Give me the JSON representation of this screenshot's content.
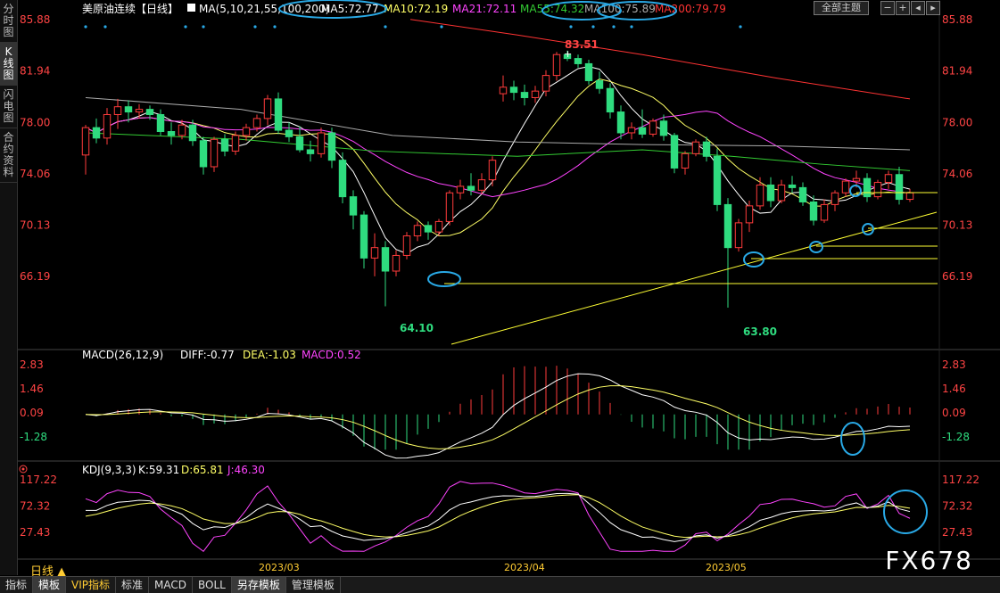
{
  "left_tabs": [
    "分时图",
    "K线图",
    "闪电图",
    "合约资料"
  ],
  "top_buttons": {
    "theme": "全部主题"
  },
  "day_button": "日线 ▲",
  "watermark": "FX678",
  "bottom_tabs": [
    "指标",
    "模板",
    "VIP指标",
    "标准",
    "MACD",
    "BOLL",
    "另存模板",
    "管理模板"
  ],
  "colors": {
    "up": "#ff3b3b",
    "down": "#2fdc7f",
    "ma5": "#ffffff",
    "ma10": "#ffff66",
    "ma21": "#ff44ff",
    "ma55": "#33cc33",
    "ma100": "#aaaaaa",
    "ma200": "#ff3333",
    "axis": "#ff4444",
    "annot": "#29a9e6"
  },
  "price_panel": {
    "title": "美原油连续【日线】",
    "ma_label": "MA(5,10,21,55,100,200)",
    "ma_values": [
      {
        "name": "MA5",
        "value": "MA5:72.77",
        "color": "#ffffff"
      },
      {
        "name": "MA10",
        "value": "MA10:72.19",
        "color": "#ffff66"
      },
      {
        "name": "MA21",
        "value": "MA21:72.11",
        "color": "#ff44ff"
      },
      {
        "name": "MA55",
        "value": "MA55:74.32",
        "color": "#33cc33"
      },
      {
        "name": "MA100",
        "value": "MA100:75.89",
        "color": "#aaaaaa"
      },
      {
        "name": "MA200",
        "value": "MA200:79.79",
        "color": "#ff3333"
      }
    ],
    "yticks": [
      "85.88",
      "81.94",
      "78.00",
      "74.06",
      "70.13",
      "66.19"
    ],
    "high_label": "83.51",
    "low_label_1": "64.10",
    "low_label_2": "63.80"
  },
  "macd_panel": {
    "label": "MACD(26,12,9)",
    "diff": "DIFF:-0.77",
    "dea": "DEA:-1.03",
    "macd": "MACD:0.52",
    "yticks": [
      "2.83",
      "1.46",
      "0.09",
      "-1.28"
    ]
  },
  "kdj_panel": {
    "label": "KDJ(9,3,3)",
    "k": "K:59.31",
    "d": "D:65.81",
    "j": "J:46.30",
    "yticks": [
      "117.22",
      "72.32",
      "27.43"
    ]
  },
  "x_labels": [
    "2023/03",
    "2023/04",
    "2023/05"
  ],
  "chart_data": [
    {
      "type": "candlestick",
      "title": "美原油连续【日线】",
      "ylim": [
        63.5,
        86.2
      ],
      "x_labels": [
        "2023/03",
        "2023/04",
        "2023/05"
      ],
      "candles": [
        [
          75.5,
          77.8,
          74.0,
          77.6
        ],
        [
          77.6,
          78.3,
          76.4,
          76.8
        ],
        [
          76.8,
          79.1,
          76.3,
          78.6
        ],
        [
          78.6,
          79.8,
          77.5,
          79.2
        ],
        [
          79.2,
          79.7,
          78.0,
          78.8
        ],
        [
          78.8,
          79.4,
          78.3,
          79.0
        ],
        [
          79.0,
          79.3,
          78.2,
          78.6
        ],
        [
          78.6,
          79.0,
          77.0,
          77.3
        ],
        [
          77.3,
          78.0,
          76.3,
          77.0
        ],
        [
          77.0,
          78.2,
          76.7,
          77.8
        ],
        [
          77.8,
          78.2,
          76.2,
          76.6
        ],
        [
          76.6,
          76.9,
          74.0,
          74.6
        ],
        [
          74.6,
          76.9,
          74.2,
          76.7
        ],
        [
          76.7,
          77.1,
          75.4,
          75.8
        ],
        [
          75.8,
          77.3,
          75.5,
          77.0
        ],
        [
          77.0,
          77.9,
          76.6,
          77.6
        ],
        [
          77.6,
          78.6,
          77.3,
          78.3
        ],
        [
          78.3,
          80.1,
          77.8,
          79.8
        ],
        [
          79.8,
          80.3,
          77.1,
          77.4
        ],
        [
          77.4,
          78.0,
          76.5,
          76.9
        ],
        [
          76.9,
          77.7,
          75.7,
          75.9
        ],
        [
          75.9,
          76.6,
          75.0,
          75.6
        ],
        [
          75.6,
          77.6,
          75.3,
          77.2
        ],
        [
          77.2,
          77.6,
          74.5,
          75.1
        ],
        [
          75.1,
          75.7,
          71.8,
          72.3
        ],
        [
          72.3,
          72.8,
          69.8,
          70.9
        ],
        [
          70.9,
          71.2,
          66.8,
          67.6
        ],
        [
          67.6,
          69.5,
          66.2,
          68.4
        ],
        [
          68.4,
          68.9,
          63.9,
          66.6
        ],
        [
          66.6,
          68.2,
          66.2,
          67.8
        ],
        [
          67.8,
          69.6,
          67.5,
          69.3
        ],
        [
          69.3,
          70.4,
          68.9,
          70.1
        ],
        [
          70.1,
          70.4,
          69.0,
          69.6
        ],
        [
          69.6,
          70.6,
          69.3,
          70.4
        ],
        [
          70.4,
          72.8,
          70.1,
          72.6
        ],
        [
          72.6,
          73.6,
          72.1,
          73.1
        ],
        [
          73.1,
          74.1,
          72.4,
          72.8
        ],
        [
          72.8,
          74.1,
          72.5,
          73.6
        ],
        [
          73.6,
          75.4,
          73.1,
          75.1
        ],
        [
          80.2,
          81.6,
          79.6,
          80.7
        ],
        [
          80.7,
          81.2,
          79.7,
          80.3
        ],
        [
          80.3,
          80.9,
          79.3,
          79.9
        ],
        [
          79.9,
          80.8,
          79.5,
          80.4
        ],
        [
          80.4,
          82.0,
          80.0,
          81.6
        ],
        [
          81.6,
          83.4,
          81.2,
          83.2
        ],
        [
          83.2,
          83.5,
          82.7,
          82.9
        ],
        [
          82.9,
          83.2,
          82.2,
          82.5
        ],
        [
          82.5,
          82.8,
          80.9,
          81.2
        ],
        [
          81.2,
          81.9,
          80.2,
          80.6
        ],
        [
          80.6,
          81.0,
          78.3,
          78.8
        ],
        [
          78.8,
          79.3,
          76.7,
          77.2
        ],
        [
          77.2,
          78.0,
          76.7,
          77.6
        ],
        [
          77.6,
          79.0,
          76.8,
          77.1
        ],
        [
          77.1,
          78.3,
          76.9,
          78.1
        ],
        [
          78.1,
          78.6,
          76.6,
          77.0
        ],
        [
          77.0,
          77.2,
          74.1,
          74.5
        ],
        [
          74.5,
          75.8,
          74.0,
          75.6
        ],
        [
          75.6,
          76.7,
          75.4,
          76.5
        ],
        [
          76.5,
          76.9,
          75.0,
          75.4
        ],
        [
          75.4,
          76.0,
          71.2,
          71.7
        ],
        [
          71.7,
          72.2,
          63.8,
          68.4
        ],
        [
          68.4,
          70.6,
          68.1,
          70.3
        ],
        [
          70.3,
          72.0,
          69.6,
          71.6
        ],
        [
          71.6,
          73.8,
          71.3,
          73.2
        ],
        [
          73.2,
          73.8,
          71.5,
          72.0
        ],
        [
          72.0,
          73.6,
          71.8,
          73.2
        ],
        [
          73.2,
          73.9,
          72.6,
          73.0
        ],
        [
          73.0,
          73.4,
          71.6,
          71.9
        ],
        [
          71.9,
          72.4,
          70.1,
          70.5
        ],
        [
          70.5,
          72.1,
          70.3,
          71.7
        ],
        [
          71.7,
          72.8,
          71.2,
          72.6
        ],
        [
          72.6,
          73.7,
          72.3,
          73.5
        ],
        [
          73.5,
          74.3,
          73.0,
          73.7
        ],
        [
          73.7,
          74.1,
          71.9,
          72.3
        ],
        [
          72.3,
          73.6,
          72.1,
          73.4
        ],
        [
          73.4,
          74.3,
          72.9,
          74.0
        ],
        [
          74.0,
          74.6,
          71.7,
          72.1
        ],
        [
          72.1,
          72.9,
          71.9,
          72.6
        ]
      ]
    },
    {
      "type": "bar",
      "title": "MACD(26,12,9)",
      "ylim": [
        -2.0,
        3.2
      ],
      "series": [
        {
          "name": "DIFF",
          "value": -0.77
        },
        {
          "name": "DEA",
          "value": -1.03
        },
        {
          "name": "MACD",
          "value": 0.52
        }
      ]
    },
    {
      "type": "line",
      "title": "KDJ(9,3,3)",
      "ylim": [
        -10,
        130
      ],
      "series": [
        {
          "name": "K",
          "value": 59.31
        },
        {
          "name": "D",
          "value": 65.81
        },
        {
          "name": "J",
          "value": 46.3
        }
      ]
    }
  ]
}
